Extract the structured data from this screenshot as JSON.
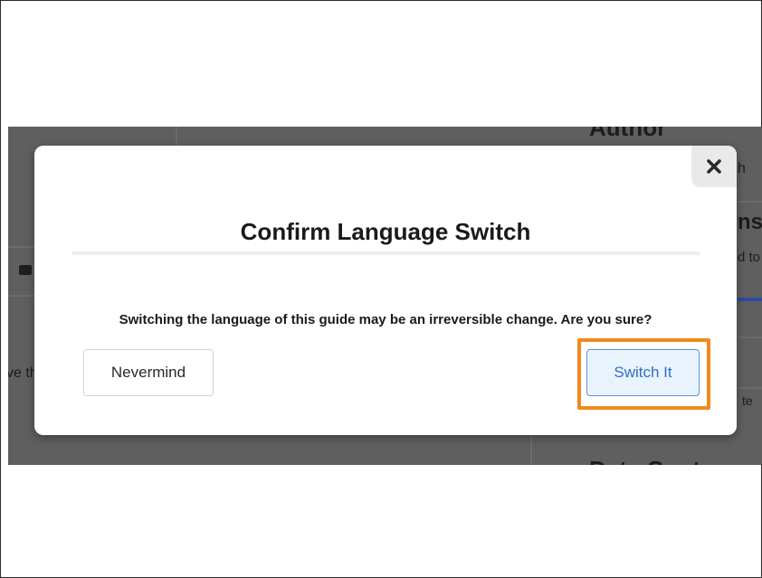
{
  "background_page": {
    "fragments": {
      "author_heading": "Author",
      "author_name_fragment": "h",
      "section_heading_fragment": "ns",
      "section_text_fragment": "d to",
      "left_text_fragment": "ve th",
      "right_input_fragment": "te",
      "bottom_heading_fragment": "Data Cont"
    }
  },
  "modal": {
    "title": "Confirm Language Switch",
    "message": "Switching the language of this guide may be an irreversible change. Are you sure?",
    "close_icon": "close-icon",
    "buttons": {
      "cancel_label": "Nevermind",
      "confirm_label": "Switch It"
    }
  },
  "annotation": {
    "highlight_color": "#f08a1c",
    "highlighted_element": "Switch It"
  },
  "colors": {
    "overlay": "#5f5f5f",
    "confirm_text": "#2f6fc4",
    "confirm_border": "#5b93d6",
    "confirm_bg": "#e9f3fd"
  }
}
